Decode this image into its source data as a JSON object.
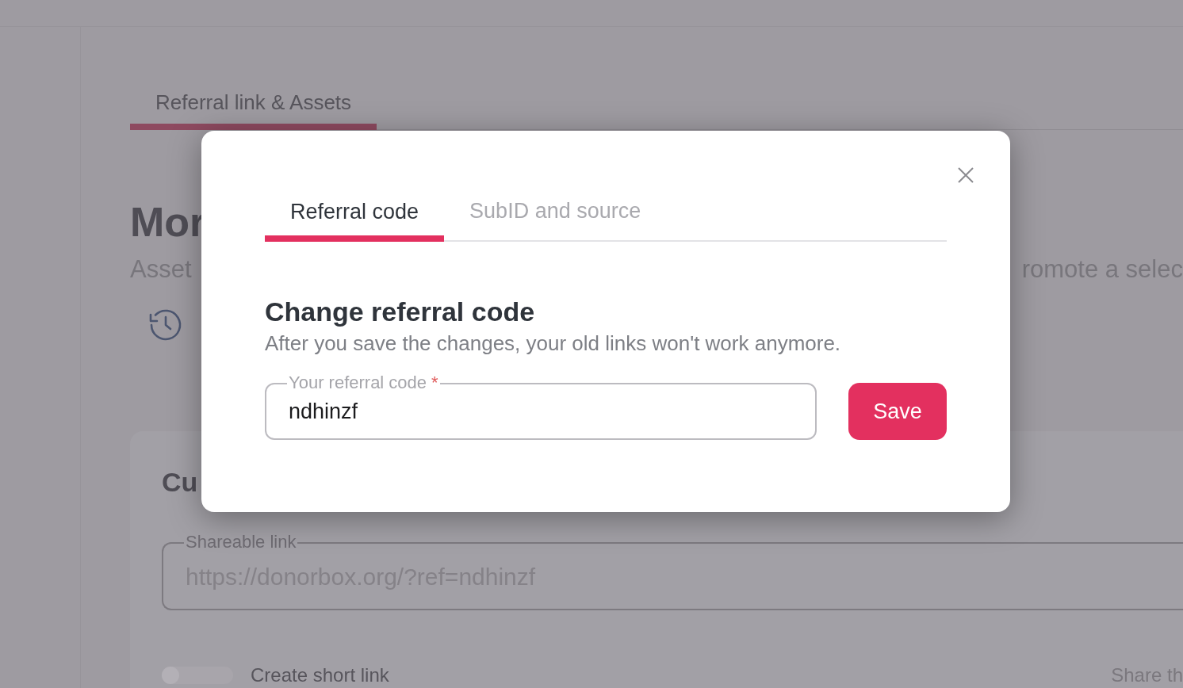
{
  "page": {
    "tabs": [
      {
        "label": "Referral link & Assets",
        "selected": true
      }
    ],
    "heading": "Mor",
    "subtitle_left": "Asset",
    "subtitle_right": "romote a selec",
    "card": {
      "heading": "Cu",
      "link_field": {
        "label": "Shareable link",
        "value": "https://donorbox.org/?ref=ndhinzf"
      },
      "short_link_toggle": {
        "label": "Create short link",
        "on": false
      },
      "share_text": "Share th"
    }
  },
  "modal": {
    "tabs": [
      {
        "label": "Referral code",
        "selected": true
      },
      {
        "label": "SubID and source",
        "selected": false
      }
    ],
    "title": "Change referral code",
    "description": "After you save the changes, your old links won't work anymore.",
    "field": {
      "label": "Your referral code",
      "required": true,
      "required_mark": "*",
      "value": "ndhinzf"
    },
    "buttons": [
      "Save"
    ]
  }
}
